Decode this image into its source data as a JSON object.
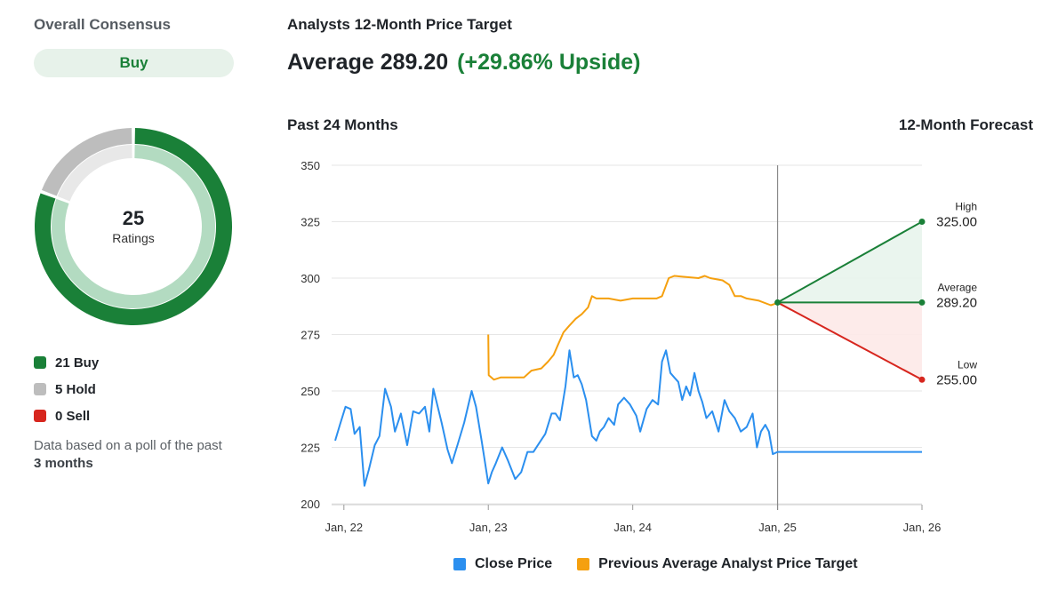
{
  "consensus": {
    "title": "Overall Consensus",
    "rating": "Buy",
    "total": "25",
    "total_label": "Ratings",
    "breakdown": [
      {
        "label": "21 Buy",
        "count": 21,
        "color": "#1a8038"
      },
      {
        "label": "5 Hold",
        "count": 5,
        "color": "#bdbdbd"
      },
      {
        "label": "0 Sell",
        "count": 0,
        "color": "#d7261e"
      }
    ],
    "note_prefix": "Data based on a poll of the past ",
    "note_bold": "3 months"
  },
  "price_target": {
    "title": "Analysts 12-Month Price Target",
    "average_text": "Average 289.20",
    "upside_text": "(+29.86% Upside)",
    "past_label": "Past 24 Months",
    "forecast_label": "12-Month Forecast"
  },
  "colors": {
    "close": "#2b8fef",
    "target": "#f5a00f",
    "green": "#1a8038",
    "red": "#d7261e"
  },
  "chart_data": {
    "type": "line",
    "ylim": [
      200,
      350
    ],
    "yticks": [
      "350",
      "325",
      "300",
      "275",
      "250",
      "225",
      "200"
    ],
    "xlim": [
      "2021-12-01",
      "2026-01-01"
    ],
    "xticks": [
      {
        "date": "2022-01-01",
        "label": "Jan, 22"
      },
      {
        "date": "2023-01-01",
        "label": "Jan, 23"
      },
      {
        "date": "2024-01-01",
        "label": "Jan, 24"
      },
      {
        "date": "2025-01-01",
        "label": "Jan, 25"
      },
      {
        "date": "2026-01-01",
        "label": "Jan, 26"
      }
    ],
    "divider_date": "2025-01-01",
    "series": [
      {
        "name": "Close Price",
        "points": [
          [
            "2021-12-10",
            228
          ],
          [
            "2021-12-22",
            235
          ],
          [
            "2022-01-05",
            243
          ],
          [
            "2022-01-18",
            242
          ],
          [
            "2022-01-28",
            231
          ],
          [
            "2022-02-10",
            234
          ],
          [
            "2022-02-22",
            208
          ],
          [
            "2022-03-05",
            215
          ],
          [
            "2022-03-20",
            226
          ],
          [
            "2022-04-01",
            230
          ],
          [
            "2022-04-15",
            251
          ],
          [
            "2022-04-30",
            243
          ],
          [
            "2022-05-10",
            232
          ],
          [
            "2022-05-25",
            240
          ],
          [
            "2022-06-10",
            226
          ],
          [
            "2022-06-25",
            241
          ],
          [
            "2022-07-10",
            240
          ],
          [
            "2022-07-25",
            243
          ],
          [
            "2022-08-05",
            232
          ],
          [
            "2022-08-15",
            251
          ],
          [
            "2022-09-05",
            236
          ],
          [
            "2022-09-20",
            224
          ],
          [
            "2022-10-01",
            218
          ],
          [
            "2022-10-15",
            226
          ],
          [
            "2022-11-01",
            236
          ],
          [
            "2022-11-20",
            250
          ],
          [
            "2022-12-01",
            243
          ],
          [
            "2022-12-15",
            228
          ],
          [
            "2023-01-01",
            209
          ],
          [
            "2023-01-10",
            214
          ],
          [
            "2023-01-20",
            218
          ],
          [
            "2023-02-05",
            225
          ],
          [
            "2023-02-20",
            219
          ],
          [
            "2023-03-10",
            211
          ],
          [
            "2023-03-25",
            214
          ],
          [
            "2023-04-10",
            223
          ],
          [
            "2023-04-25",
            223
          ],
          [
            "2023-05-10",
            227
          ],
          [
            "2023-05-25",
            231
          ],
          [
            "2023-06-10",
            240
          ],
          [
            "2023-06-20",
            240
          ],
          [
            "2023-07-01",
            237
          ],
          [
            "2023-07-15",
            252
          ],
          [
            "2023-07-25",
            268
          ],
          [
            "2023-08-05",
            256
          ],
          [
            "2023-08-15",
            257
          ],
          [
            "2023-08-25",
            253
          ],
          [
            "2023-09-05",
            246
          ],
          [
            "2023-09-20",
            230
          ],
          [
            "2023-10-01",
            228
          ],
          [
            "2023-10-10",
            232
          ],
          [
            "2023-10-20",
            234
          ],
          [
            "2023-11-01",
            238
          ],
          [
            "2023-11-15",
            235
          ],
          [
            "2023-11-25",
            244
          ],
          [
            "2023-12-10",
            247
          ],
          [
            "2023-12-25",
            244
          ],
          [
            "2024-01-10",
            239
          ],
          [
            "2024-01-20",
            232
          ],
          [
            "2024-02-05",
            242
          ],
          [
            "2024-02-20",
            246
          ],
          [
            "2024-03-05",
            244
          ],
          [
            "2024-03-15",
            263
          ],
          [
            "2024-03-25",
            268
          ],
          [
            "2024-04-05",
            258
          ],
          [
            "2024-04-15",
            256
          ],
          [
            "2024-04-25",
            254
          ],
          [
            "2024-05-05",
            246
          ],
          [
            "2024-05-15",
            252
          ],
          [
            "2024-05-25",
            248
          ],
          [
            "2024-06-05",
            258
          ],
          [
            "2024-06-15",
            250
          ],
          [
            "2024-06-25",
            245
          ],
          [
            "2024-07-05",
            238
          ],
          [
            "2024-07-20",
            241
          ],
          [
            "2024-08-05",
            232
          ],
          [
            "2024-08-20",
            246
          ],
          [
            "2024-09-01",
            241
          ],
          [
            "2024-09-15",
            238
          ],
          [
            "2024-09-30",
            232
          ],
          [
            "2024-10-15",
            234
          ],
          [
            "2024-10-30",
            240
          ],
          [
            "2024-11-10",
            225
          ],
          [
            "2024-11-20",
            232
          ],
          [
            "2024-12-01",
            235
          ],
          [
            "2024-12-10",
            232
          ],
          [
            "2024-12-20",
            222
          ],
          [
            "2025-01-01",
            223
          ],
          [
            "2026-01-01",
            223
          ]
        ]
      },
      {
        "name": "Previous Average Analyst Price Target",
        "points": [
          [
            "2023-01-01",
            275
          ],
          [
            "2023-01-02",
            257
          ],
          [
            "2023-01-15",
            255
          ],
          [
            "2023-02-01",
            256
          ],
          [
            "2023-03-01",
            256
          ],
          [
            "2023-04-01",
            256
          ],
          [
            "2023-04-20",
            259
          ],
          [
            "2023-05-15",
            260
          ],
          [
            "2023-06-01",
            263
          ],
          [
            "2023-06-15",
            266
          ],
          [
            "2023-06-25",
            270
          ],
          [
            "2023-07-10",
            276
          ],
          [
            "2023-07-25",
            279
          ],
          [
            "2023-08-10",
            282
          ],
          [
            "2023-08-25",
            284
          ],
          [
            "2023-09-10",
            287
          ],
          [
            "2023-09-20",
            292
          ],
          [
            "2023-10-01",
            291
          ],
          [
            "2023-10-15",
            291
          ],
          [
            "2023-11-01",
            291
          ],
          [
            "2023-12-01",
            290
          ],
          [
            "2024-01-01",
            291
          ],
          [
            "2024-03-01",
            291
          ],
          [
            "2024-03-15",
            292
          ],
          [
            "2024-04-01",
            300
          ],
          [
            "2024-04-15",
            301
          ],
          [
            "2024-06-15",
            300
          ],
          [
            "2024-07-01",
            301
          ],
          [
            "2024-07-15",
            300
          ],
          [
            "2024-08-15",
            299
          ],
          [
            "2024-09-01",
            297
          ],
          [
            "2024-09-15",
            292
          ],
          [
            "2024-10-01",
            292
          ],
          [
            "2024-10-15",
            291
          ],
          [
            "2024-11-15",
            290
          ],
          [
            "2024-12-15",
            288
          ],
          [
            "2025-01-01",
            289
          ]
        ]
      }
    ],
    "forecast": {
      "start": {
        "date": "2025-01-01",
        "value": 289.2
      },
      "end_date": "2026-01-01",
      "high": {
        "label": "High",
        "value": 325.0,
        "value_label": "325.00"
      },
      "average": {
        "label": "Average",
        "value": 289.2,
        "value_label": "289.20"
      },
      "low": {
        "label": "Low",
        "value": 255.0,
        "value_label": "255.00"
      }
    }
  },
  "chart_legend": [
    {
      "label": "Close Price",
      "color": "#2b8fef"
    },
    {
      "label": "Previous Average Analyst Price Target",
      "color": "#f5a00f"
    }
  ]
}
